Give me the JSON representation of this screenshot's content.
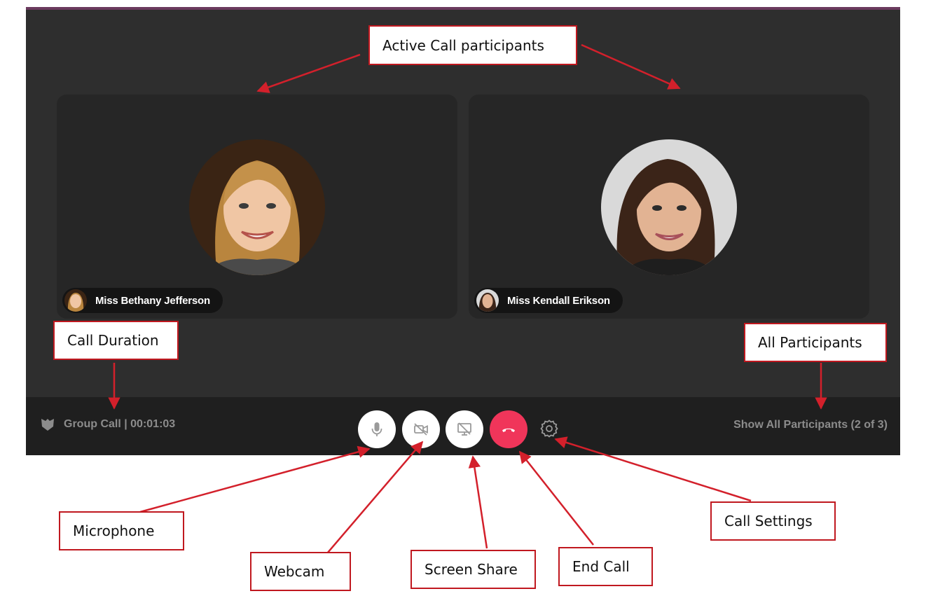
{
  "participants": [
    {
      "name": "Miss Bethany Jefferson"
    },
    {
      "name": "Miss Kendall Erikson"
    }
  ],
  "control_bar": {
    "call_info": "Group Call | 00:01:03",
    "show_all": "Show All Participants (2 of 3)",
    "icons": {
      "group": "shield-group-icon",
      "mic": "microphone-icon",
      "cam": "webcam-off-icon",
      "screen": "screen-share-off-icon",
      "end": "hang-up-icon",
      "settings": "gear-icon"
    }
  },
  "annotations": {
    "active_participants": "Active Call participants",
    "call_duration": "Call Duration",
    "all_participants": "All Participants",
    "microphone": "Microphone",
    "webcam": "Webcam",
    "screen_share": "Screen Share",
    "end_call": "End Call",
    "call_settings": "Call Settings"
  },
  "colors": {
    "window_bg": "#2e2e2e",
    "tile_bg": "#262626",
    "bar_bg": "#1f1f1f",
    "end_call": "#f0355a",
    "annotation_border": "#c0181f",
    "top_accent": "#6b3a5e"
  }
}
